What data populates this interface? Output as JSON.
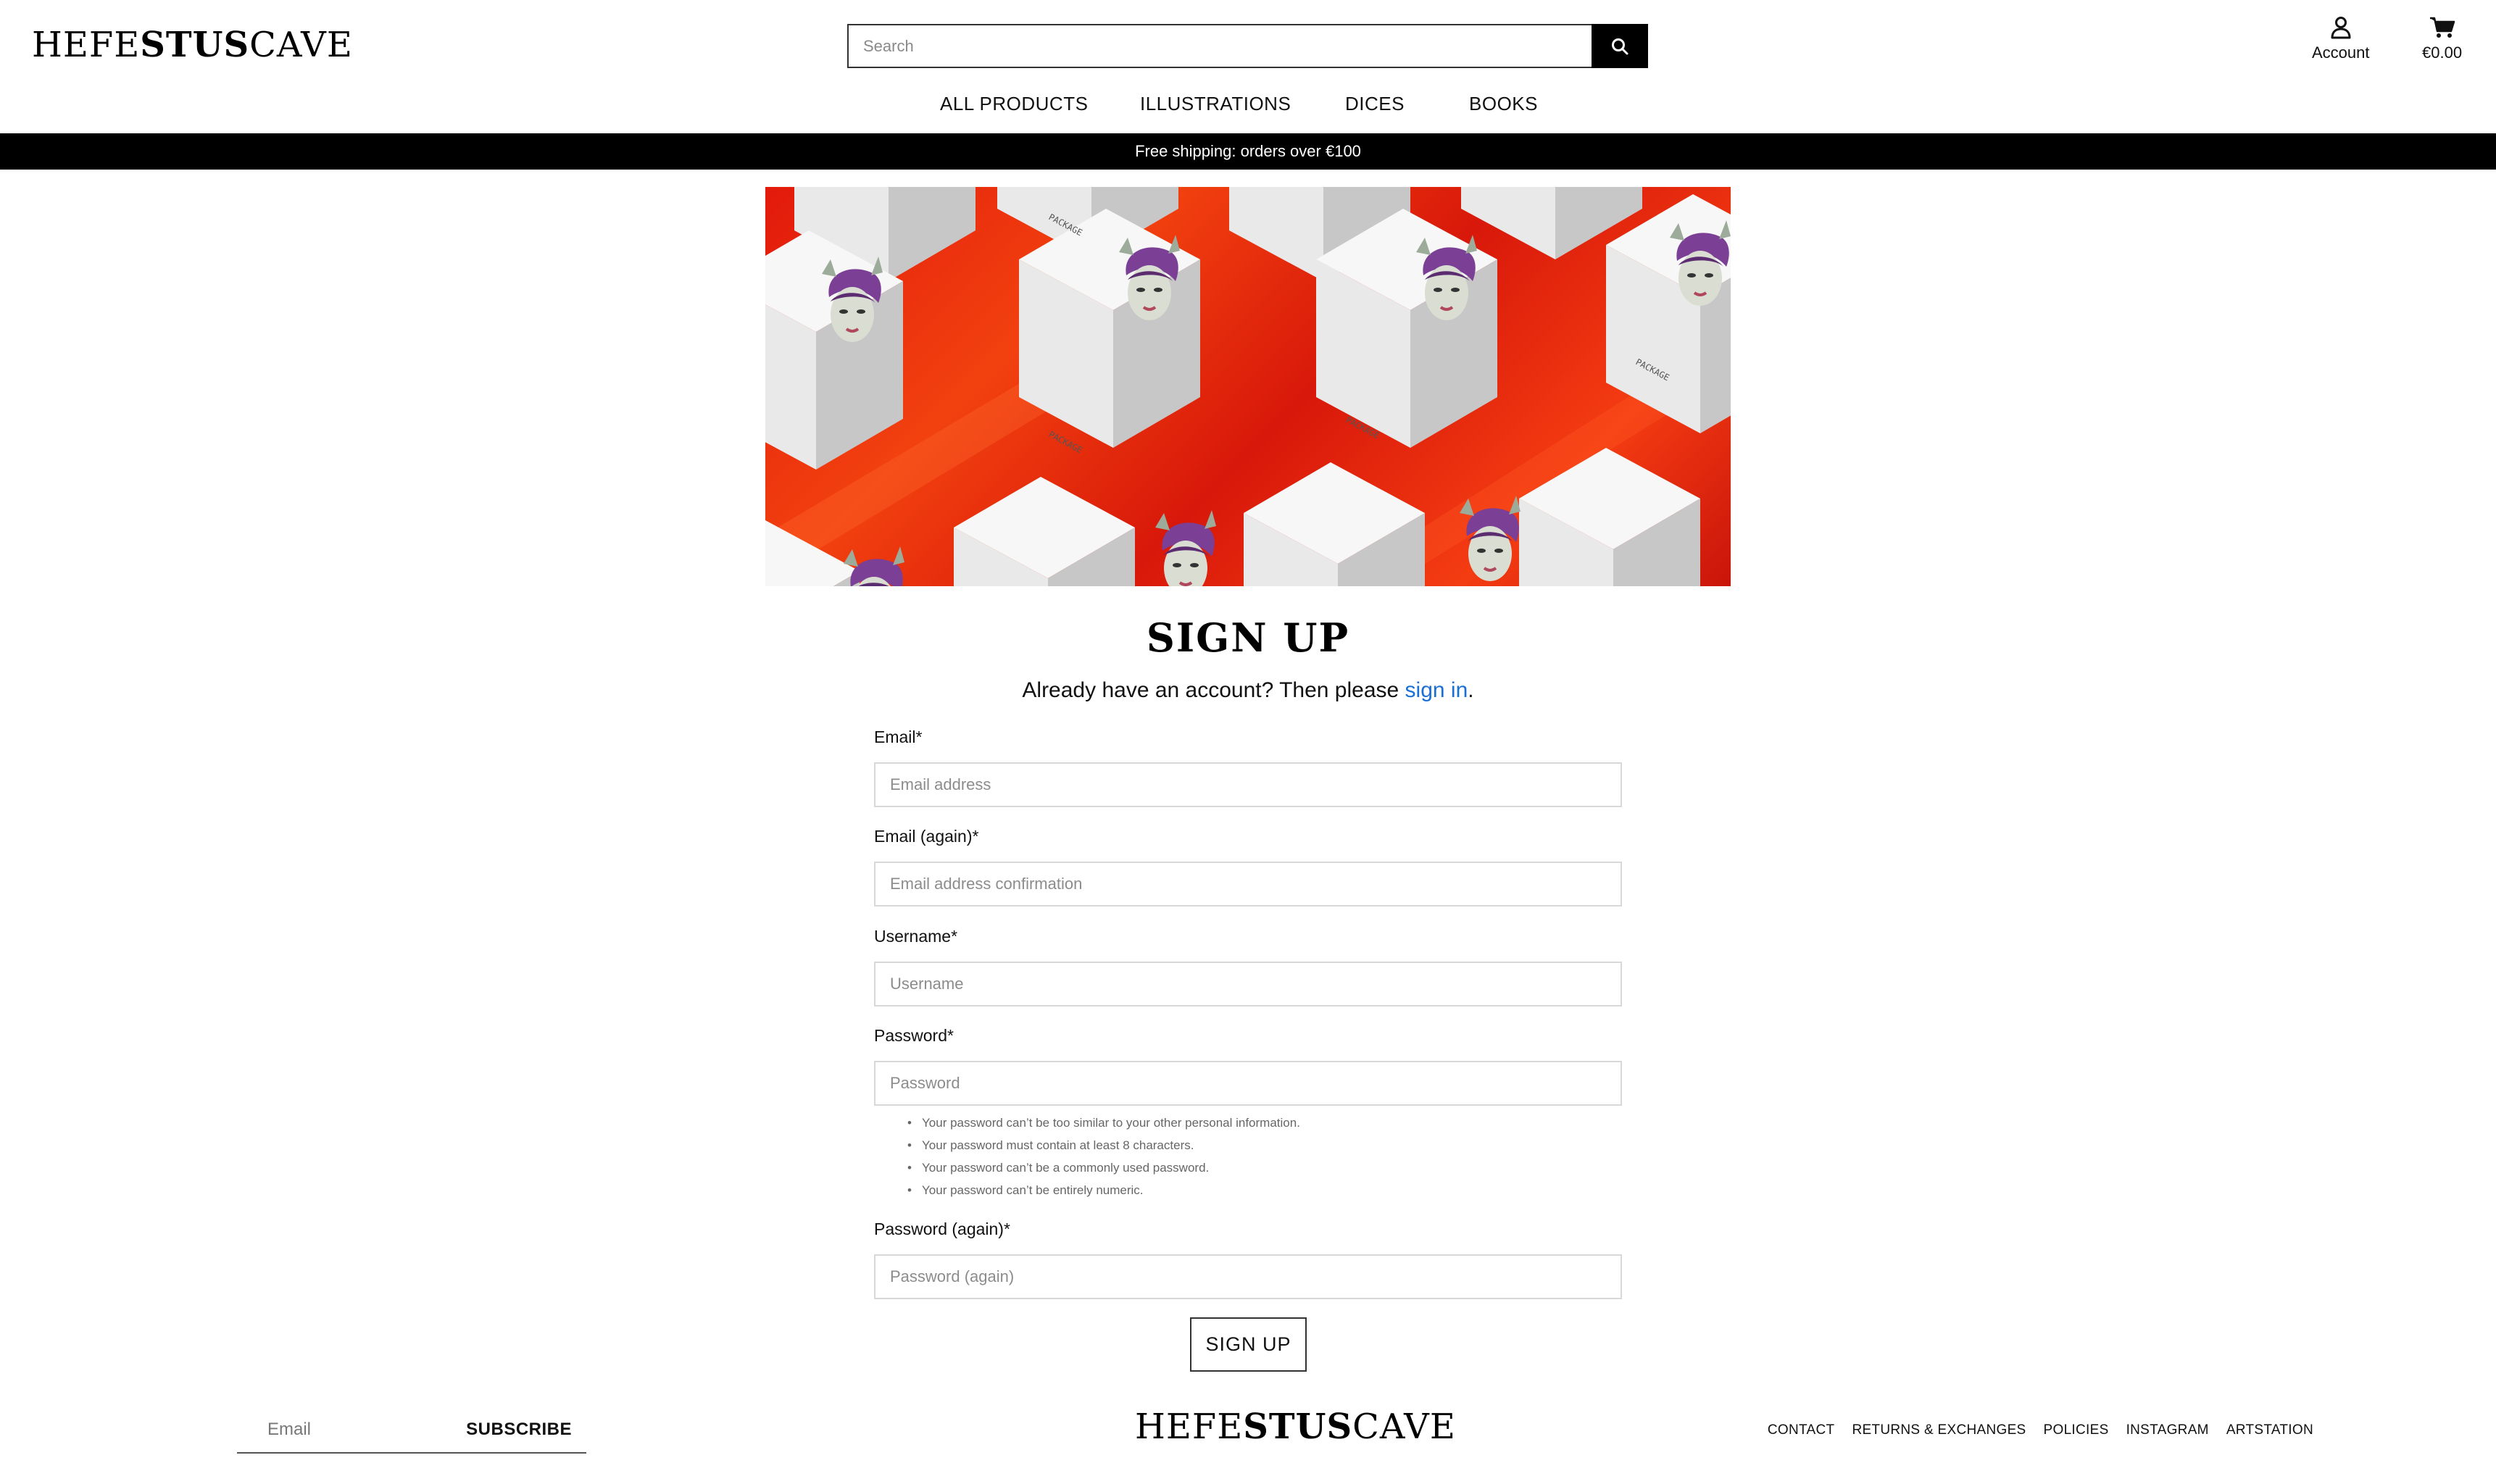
{
  "brand": {
    "logo_a": "HEFE",
    "logo_b": "STUS",
    "logo_c": "CAVE"
  },
  "header": {
    "search_placeholder": "Search",
    "account_label": "Account",
    "cart_total": "€0.00"
  },
  "nav": {
    "items": [
      {
        "label": "ALL PRODUCTS"
      },
      {
        "label": "ILLUSTRATIONS"
      },
      {
        "label": "DICES"
      },
      {
        "label": "BOOKS"
      }
    ]
  },
  "promo": {
    "text": "Free shipping: orders over €100"
  },
  "hero": {
    "box_text": "PACKAGE",
    "colors": {
      "background": "#e4200d",
      "box": "#ffffff",
      "hair": "#7b3f95"
    }
  },
  "form": {
    "title": "SIGN UP",
    "signin_prefix": "Already have an account? Then please ",
    "signin_link": "sign in",
    "signin_suffix": ".",
    "fields": [
      {
        "label": "Email*",
        "placeholder": "Email address"
      },
      {
        "label": "Email (again)*",
        "placeholder": "Email address confirmation"
      },
      {
        "label": "Username*",
        "placeholder": "Username"
      },
      {
        "label": "Password*",
        "placeholder": "Password"
      },
      {
        "label": "Password (again)*",
        "placeholder": "Password (again)"
      }
    ],
    "password_help": [
      "Your password can’t be too similar to your other personal information.",
      "Your password must contain at least 8 characters.",
      "Your password can’t be a commonly used password.",
      "Your password can’t be entirely numeric."
    ],
    "submit_label": "SIGN UP"
  },
  "footer": {
    "email_placeholder": "Email",
    "subscribe_label": "SUBSCRIBE",
    "links": [
      "CONTACT",
      "RETURNS & EXCHANGES",
      "POLICIES",
      "INSTAGRAM",
      "ARTSTATION"
    ]
  },
  "colors": {
    "accent_link": "#1a6fd6",
    "promo_bar": "#000000"
  }
}
